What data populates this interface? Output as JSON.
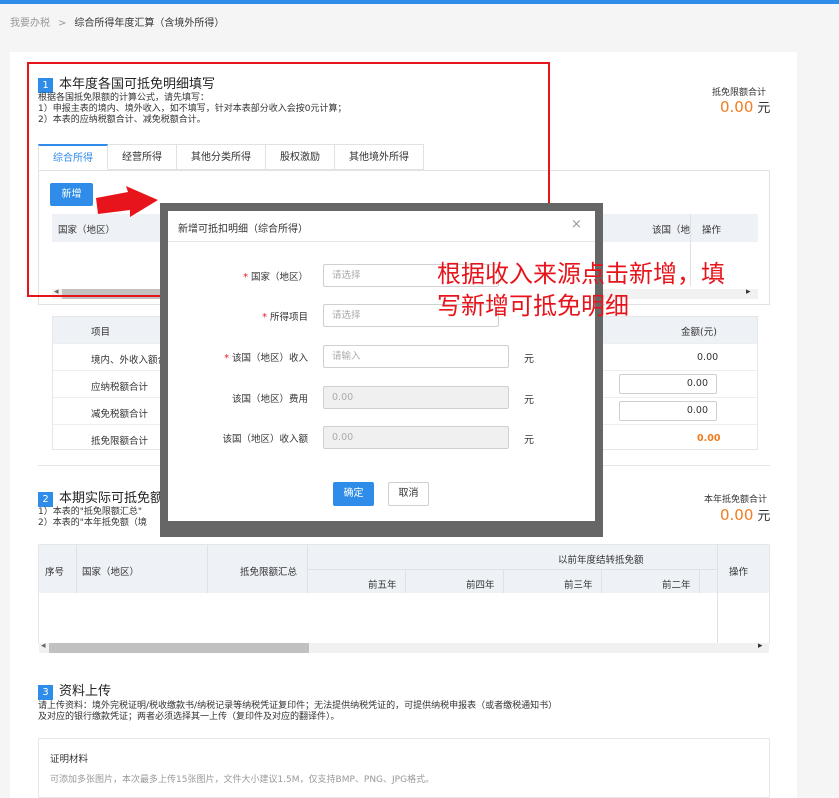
{
  "breadcrumb": {
    "parent": "我要办税",
    "separator": ">",
    "current": "综合所得年度汇算（含境外所得）"
  },
  "section1": {
    "num": "1",
    "title": "本年度各国可抵免明细填写",
    "desc": [
      "根据各国抵免限额的计算公式，请先填写：",
      "1）申报主表的境内、境外收入，如不填写，针对本表部分收入会按0元计算；",
      "2）本表的应纳税额合计、减免税额合计。"
    ],
    "total_label": "抵免限额合计",
    "total_value": "0.00",
    "unit": "元",
    "tabs": [
      "综合所得",
      "经营所得",
      "其他分类所得",
      "股权激励",
      "其他境外所得"
    ],
    "add_button": "新增",
    "col_country": "国家（地区）",
    "col_income": "该国（地",
    "col_action": "操作"
  },
  "summary": {
    "col_item": "项目",
    "col_amount": "金额(元)",
    "rows": [
      {
        "label": "境内、外收入额合计",
        "value": "0.00"
      },
      {
        "label": "应纳税额合计",
        "value": "0.00"
      },
      {
        "label": "减免税额合计",
        "value": "0.00"
      },
      {
        "label": "抵免限额合计",
        "value": "0.00"
      }
    ]
  },
  "section2": {
    "num": "2",
    "title": "本期实际可抵免额",
    "desc": [
      "1）本表的\"抵免限额汇总\"",
      "2）本表的\"本年抵免额（境"
    ],
    "total_label": "本年抵免额合计",
    "total_value": "0.00",
    "unit": "元",
    "col_seq": "序号",
    "col_country": "国家（地区）",
    "col_limit": "抵免限额汇总",
    "col_group": "以前年度结转抵免额",
    "sub_cols": [
      "前五年",
      "前四年",
      "前三年",
      "前二年"
    ],
    "col_action": "操作"
  },
  "section3": {
    "num": "3",
    "title": "资料上传",
    "desc": [
      "请上传资料：境外完税证明/税收缴款书/纳税记录等纳税凭证复印件；无法提供纳税凭证的，可提供纳税申报表（或者缴税通知书）",
      "及对应的银行缴款凭证；两者必须选择其一上传（复印件及对应的翻译件）。"
    ],
    "box_title": "证明材料",
    "box_hint": "可添加多张图片，本次最多上传15张图片，文件大小建议1.5M，仅支持BMP、PNG、JPG格式。"
  },
  "modal": {
    "title": "新增可抵扣明细（综合所得）",
    "close": "×",
    "fields": [
      {
        "label": "国家（地区）",
        "required": true,
        "placeholder": "请选择",
        "unit": ""
      },
      {
        "label": "所得项目",
        "required": true,
        "placeholder": "请选择",
        "unit": ""
      },
      {
        "label": "该国（地区）收入",
        "required": true,
        "placeholder": "请输入",
        "unit": "元"
      },
      {
        "label": "该国（地区）费用",
        "required": false,
        "placeholder": "0.00",
        "unit": "元"
      },
      {
        "label": "该国（地区）收入额",
        "required": false,
        "placeholder": "0.00",
        "unit": "元"
      }
    ],
    "confirm": "确定",
    "cancel": "取消",
    "required_mark": "*"
  },
  "annotation": {
    "line1": "根据收入来源点击新增，填",
    "line2": "写新增可抵免明细"
  },
  "colors": {
    "primary": "#2f8ce8",
    "accent_red": "#e8141b",
    "amount_orange": "#f07c1f"
  }
}
